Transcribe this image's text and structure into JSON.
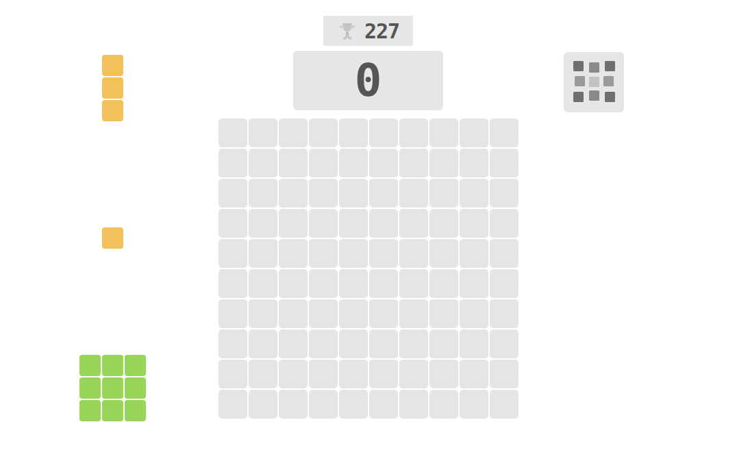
{
  "best_score": {
    "value": "227"
  },
  "score": {
    "value": "0"
  },
  "board": {
    "rows": [
      [
        false,
        false,
        false,
        false,
        false,
        false,
        false,
        false,
        false,
        false
      ],
      [
        false,
        false,
        false,
        false,
        false,
        false,
        false,
        false,
        false,
        false
      ],
      [
        false,
        false,
        false,
        false,
        false,
        false,
        false,
        false,
        false,
        false
      ],
      [
        false,
        false,
        false,
        false,
        false,
        false,
        false,
        false,
        false,
        false
      ],
      [
        false,
        false,
        false,
        false,
        false,
        false,
        false,
        false,
        false,
        false
      ],
      [
        false,
        false,
        false,
        false,
        false,
        false,
        false,
        false,
        false,
        false
      ],
      [
        false,
        false,
        false,
        false,
        false,
        false,
        false,
        false,
        false,
        false
      ],
      [
        false,
        false,
        false,
        false,
        false,
        false,
        false,
        false,
        false,
        false
      ],
      [
        false,
        false,
        false,
        false,
        false,
        false,
        false,
        false,
        false,
        false
      ],
      [
        false,
        false,
        false,
        false,
        false,
        false,
        false,
        false,
        false,
        false
      ]
    ]
  },
  "pieces": [
    {
      "cells": [
        [
          true
        ],
        [
          true
        ],
        [
          true
        ]
      ],
      "color": "#f3c15b"
    },
    {
      "cells": [
        [
          true
        ]
      ],
      "color": "#f3c15b"
    },
    {
      "cells": [
        [
          true,
          true,
          true
        ],
        [
          true,
          true,
          true
        ],
        [
          true,
          true,
          true
        ]
      ],
      "color": "#98d65a"
    }
  ]
}
